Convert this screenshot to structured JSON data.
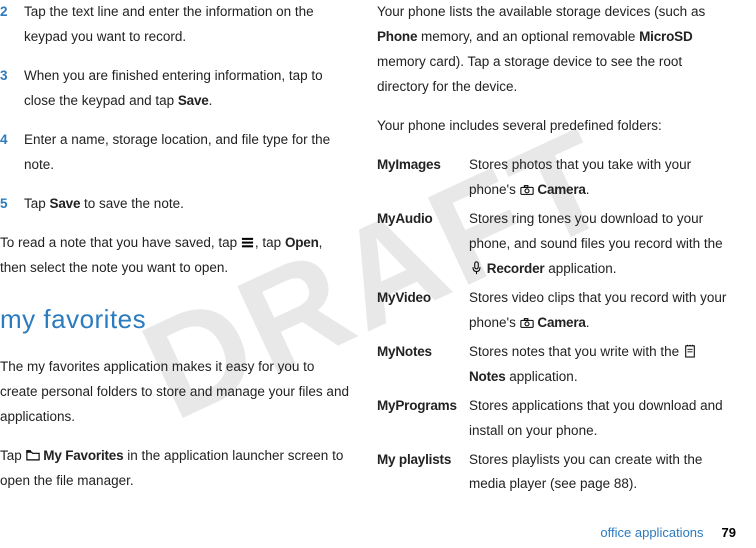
{
  "watermark": "DRAFT",
  "left": {
    "steps": [
      {
        "num": "2",
        "text_a": "Tap the text line and enter the information on the keypad you want to record."
      },
      {
        "num": "3",
        "text_a": "When you are finished entering information, tap to close the keypad and tap ",
        "text_b": "Save",
        "text_c": "."
      },
      {
        "num": "4",
        "text_a": "Enter a name, storage location, and file type for the note."
      },
      {
        "num": "5",
        "text_a": "Tap ",
        "text_b": "Save",
        "text_c": " to save the note."
      }
    ],
    "read_note_a": "To read a note that you have saved, tap ",
    "read_note_b": ", tap ",
    "read_note_c": "Open",
    "read_note_d": ", then select the note you want to open.",
    "section_title": "my favorites",
    "fav_para": "The my favorites application makes it easy for you to create personal folders to store and manage your files and applications.",
    "fav_tap_a": "Tap ",
    "fav_tap_b": "My Favorites",
    "fav_tap_c": " in the application launcher screen to open the file manager."
  },
  "right": {
    "intro_a": "Your phone lists the available storage devices (such as ",
    "intro_b": "Phone",
    "intro_c": " memory, and an optional removable ",
    "intro_d": "MicroSD",
    "intro_e": " memory card). Tap a storage device to see the root directory for the device.",
    "predef": "Your phone includes several predefined folders:",
    "folders": [
      {
        "name": "MyImages",
        "desc_a": "Stores photos that you take with your phone's ",
        "desc_b": "Camera",
        "desc_c": "."
      },
      {
        "name": "MyAudio",
        "desc_a": "Stores ring tones you download to your phone, and sound files you record with the ",
        "desc_b": "Recorder",
        "desc_c": " application."
      },
      {
        "name": "MyVideo",
        "desc_a": "Stores video clips that you record with your phone's ",
        "desc_b": "Camera",
        "desc_c": "."
      },
      {
        "name": "MyNotes",
        "desc_a": "Stores notes that you write with the ",
        "desc_b": "Notes",
        "desc_c": " application."
      },
      {
        "name": "MyPrograms",
        "desc_a": "Stores applications that you download and install on your phone.",
        "desc_b": "",
        "desc_c": ""
      },
      {
        "name": "My playlists",
        "desc_a": "Stores playlists you can create with the media player (see page 88).",
        "desc_b": "",
        "desc_c": ""
      }
    ]
  },
  "footer": {
    "label": "office applications",
    "page": "79"
  }
}
